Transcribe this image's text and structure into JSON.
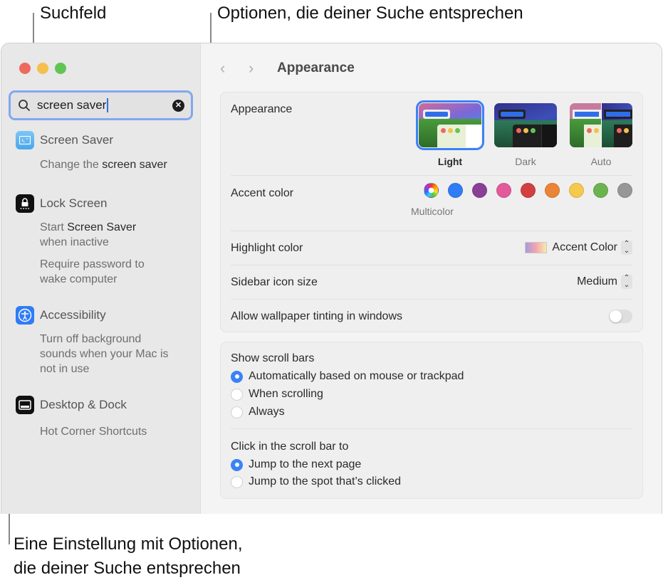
{
  "callouts": {
    "search_field": "Suchfeld",
    "matching_options": "Optionen, die deiner Suche entsprechen",
    "setting_line1": "Eine Einstellung mit Optionen,",
    "setting_line2": "die deiner Suche entsprechen"
  },
  "sidebar": {
    "search": {
      "value": "screen saver",
      "icon": "magnifier-icon",
      "clear_icon": "clear-icon"
    },
    "results": [
      {
        "title": "Screen Saver",
        "icon": "screen-saver-icon",
        "icon_color": "#5fb4ee",
        "options": [
          {
            "pre": "Change the ",
            "match": "screen saver",
            "post": ""
          }
        ]
      },
      {
        "title": "Lock Screen",
        "icon": "lock-icon",
        "icon_color": "#111111",
        "options": [
          {
            "pre": "Start ",
            "match": "Screen Saver",
            "post": "",
            "line2": "when inactive"
          },
          {
            "pre": "Require password to",
            "match": "",
            "post": "",
            "line2": "wake computer"
          }
        ]
      },
      {
        "title": "Accessibility",
        "icon": "accessibility-icon",
        "icon_color": "#2f7cf6",
        "options": [
          {
            "line1": "Turn off background",
            "line2": "sounds when your Mac is",
            "line3": "not in use"
          }
        ]
      },
      {
        "title": "Desktop & Dock",
        "icon": "desktop-dock-icon",
        "icon_color": "#111111",
        "options": [
          {
            "line1": "Hot Corner Shortcuts"
          }
        ]
      }
    ]
  },
  "content": {
    "nav": {
      "back": "‹",
      "forward": "›",
      "title": "Appearance"
    },
    "appearance": {
      "label": "Appearance",
      "options": [
        {
          "label": "Light",
          "selected": true
        },
        {
          "label": "Dark",
          "selected": false
        },
        {
          "label": "Auto",
          "selected": false
        }
      ]
    },
    "accent": {
      "label": "Accent color",
      "selected_label": "Multicolor",
      "colors": [
        "multicolor",
        "#2f7cf6",
        "#8a3f97",
        "#e35a9b",
        "#d33f3f",
        "#ea8436",
        "#f5c94b",
        "#6bb34f",
        "#979797"
      ]
    },
    "highlight": {
      "label": "Highlight color",
      "value": "Accent Color"
    },
    "sidebar_icon_size": {
      "label": "Sidebar icon size",
      "value": "Medium"
    },
    "wallpaper_tinting": {
      "label": "Allow wallpaper tinting in windows",
      "enabled": false
    },
    "scroll_bars": {
      "title": "Show scroll bars",
      "options": [
        {
          "label": "Automatically based on mouse or trackpad",
          "selected": true
        },
        {
          "label": "When scrolling",
          "selected": false
        },
        {
          "label": "Always",
          "selected": false
        }
      ]
    },
    "click_scroll": {
      "title": "Click in the scroll bar to",
      "options": [
        {
          "label": "Jump to the next page",
          "selected": true
        },
        {
          "label": "Jump to the spot that’s clicked",
          "selected": false
        }
      ]
    }
  }
}
